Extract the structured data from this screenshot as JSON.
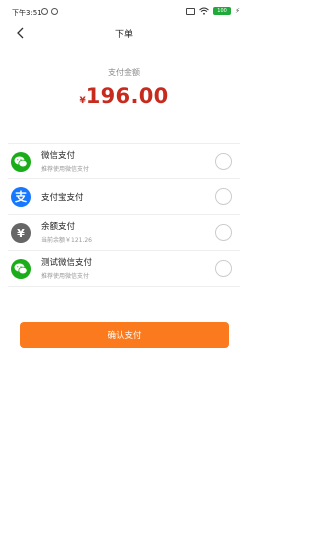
{
  "status_bar": {
    "time": "下午3:51",
    "battery_level": "100"
  },
  "nav": {
    "title": "下单"
  },
  "payment": {
    "amount_label": "支付金额",
    "currency_symbol": "¥",
    "amount": "196.00"
  },
  "methods": [
    {
      "icon": "wechat-icon",
      "title": "微信支付",
      "subtitle": "推荐使用微信支付",
      "color": "#1aad19"
    },
    {
      "icon": "alipay-icon",
      "title": "支付宝支付",
      "subtitle": "",
      "color": "#1677ff"
    },
    {
      "icon": "balance-icon",
      "title": "余额支付",
      "subtitle": "当前余额￥121.26",
      "color": "#666666"
    },
    {
      "icon": "wechat-icon",
      "title": "测试微信支付",
      "subtitle": "推荐使用微信支付",
      "color": "#1aad19"
    }
  ],
  "confirm_label": "确认支付",
  "colors": {
    "accent": "#fb7a1d",
    "amount": "#c62b1e"
  }
}
